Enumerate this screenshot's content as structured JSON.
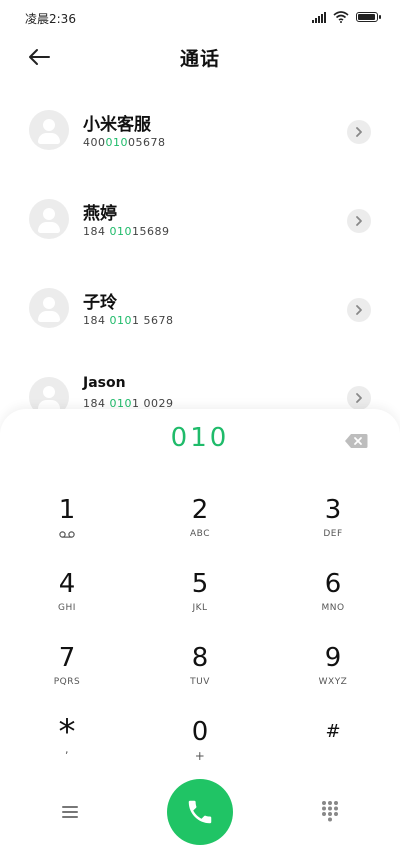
{
  "status_bar": {
    "time": "凌晨2:36"
  },
  "header": {
    "title": "通话"
  },
  "contacts": [
    {
      "name": "小米客服",
      "number_before": "400",
      "number_match": "010",
      "number_after": "05678"
    },
    {
      "name": "燕婷",
      "number_before": "184 ",
      "number_match": "010",
      "number_after": "15689"
    },
    {
      "name": "子玲",
      "number_before": "184 ",
      "number_match": "010",
      "number_after": "1 5678"
    },
    {
      "name": "Jason",
      "number_before": "184 ",
      "number_match": "010",
      "number_after": "1 0029"
    }
  ],
  "dialpad": {
    "input": "010",
    "keys": [
      {
        "digit": "1",
        "letters": ""
      },
      {
        "digit": "2",
        "letters": "ABC"
      },
      {
        "digit": "3",
        "letters": "DEF"
      },
      {
        "digit": "4",
        "letters": "GHI"
      },
      {
        "digit": "5",
        "letters": "JKL"
      },
      {
        "digit": "6",
        "letters": "MNO"
      },
      {
        "digit": "7",
        "letters": "PQRS"
      },
      {
        "digit": "8",
        "letters": "TUV"
      },
      {
        "digit": "9",
        "letters": "WXYZ"
      },
      {
        "digit": "*",
        "letters": ","
      },
      {
        "digit": "0",
        "letters": "+"
      },
      {
        "digit": "#",
        "letters": ""
      }
    ]
  },
  "colors": {
    "accent_green": "#1fbb6a",
    "call_button": "#20c465"
  },
  "icons": {
    "back": "arrow-left-icon",
    "detail": "chevron-right-icon",
    "backspace": "backspace-icon",
    "voicemail": "voicemail-icon",
    "menu": "menu-icon",
    "call": "phone-icon",
    "keypad": "dialpad-icon"
  }
}
